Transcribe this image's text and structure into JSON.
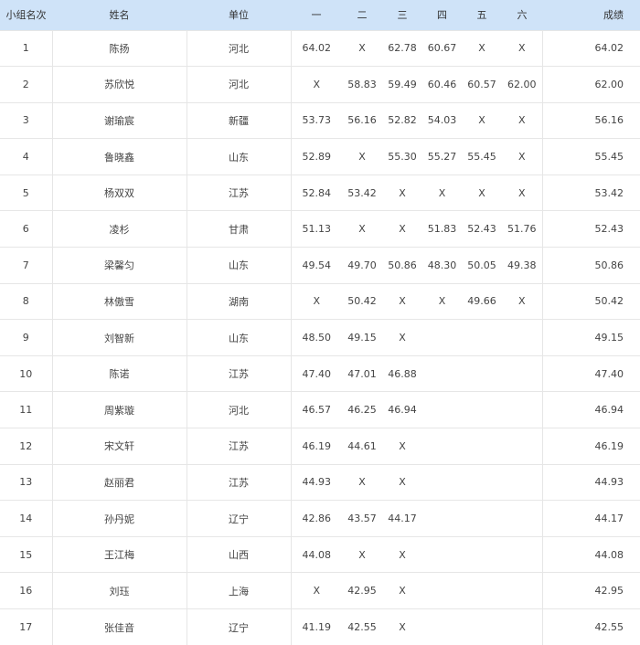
{
  "columns": [
    "小组名次",
    "姓名",
    "单位",
    "一",
    "二",
    "三",
    "四",
    "五",
    "六",
    "成绩"
  ],
  "rows": [
    [
      "1",
      "陈扬",
      "河北",
      "64.02",
      "X",
      "62.78",
      "60.67",
      "X",
      "X",
      "64.02"
    ],
    [
      "2",
      "苏欣悦",
      "河北",
      "X",
      "58.83",
      "59.49",
      "60.46",
      "60.57",
      "62.00",
      "62.00"
    ],
    [
      "3",
      "谢瑜宸",
      "新疆",
      "53.73",
      "56.16",
      "52.82",
      "54.03",
      "X",
      "X",
      "56.16"
    ],
    [
      "4",
      "鲁晓鑫",
      "山东",
      "52.89",
      "X",
      "55.30",
      "55.27",
      "55.45",
      "X",
      "55.45"
    ],
    [
      "5",
      "杨双双",
      "江苏",
      "52.84",
      "53.42",
      "X",
      "X",
      "X",
      "X",
      "53.42"
    ],
    [
      "6",
      "凌杉",
      "甘肃",
      "51.13",
      "X",
      "X",
      "51.83",
      "52.43",
      "51.76",
      "52.43"
    ],
    [
      "7",
      "梁馨匀",
      "山东",
      "49.54",
      "49.70",
      "50.86",
      "48.30",
      "50.05",
      "49.38",
      "50.86"
    ],
    [
      "8",
      "林傲雪",
      "湖南",
      "X",
      "50.42",
      "X",
      "X",
      "49.66",
      "X",
      "50.42"
    ],
    [
      "9",
      "刘智新",
      "山东",
      "48.50",
      "49.15",
      "X",
      "",
      "",
      "",
      "49.15"
    ],
    [
      "10",
      "陈诺",
      "江苏",
      "47.40",
      "47.01",
      "46.88",
      "",
      "",
      "",
      "47.40"
    ],
    [
      "11",
      "周紫璇",
      "河北",
      "46.57",
      "46.25",
      "46.94",
      "",
      "",
      "",
      "46.94"
    ],
    [
      "12",
      "宋文轩",
      "江苏",
      "46.19",
      "44.61",
      "X",
      "",
      "",
      "",
      "46.19"
    ],
    [
      "13",
      "赵丽君",
      "江苏",
      "44.93",
      "X",
      "X",
      "",
      "",
      "",
      "44.93"
    ],
    [
      "14",
      "孙丹妮",
      "辽宁",
      "42.86",
      "43.57",
      "44.17",
      "",
      "",
      "",
      "44.17"
    ],
    [
      "15",
      "王江梅",
      "山西",
      "44.08",
      "X",
      "X",
      "",
      "",
      "",
      "44.08"
    ],
    [
      "16",
      "刘珏",
      "上海",
      "X",
      "42.95",
      "X",
      "",
      "",
      "",
      "42.95"
    ],
    [
      "17",
      "张佳音",
      "辽宁",
      "41.19",
      "42.55",
      "X",
      "",
      "",
      "",
      "42.55"
    ]
  ]
}
